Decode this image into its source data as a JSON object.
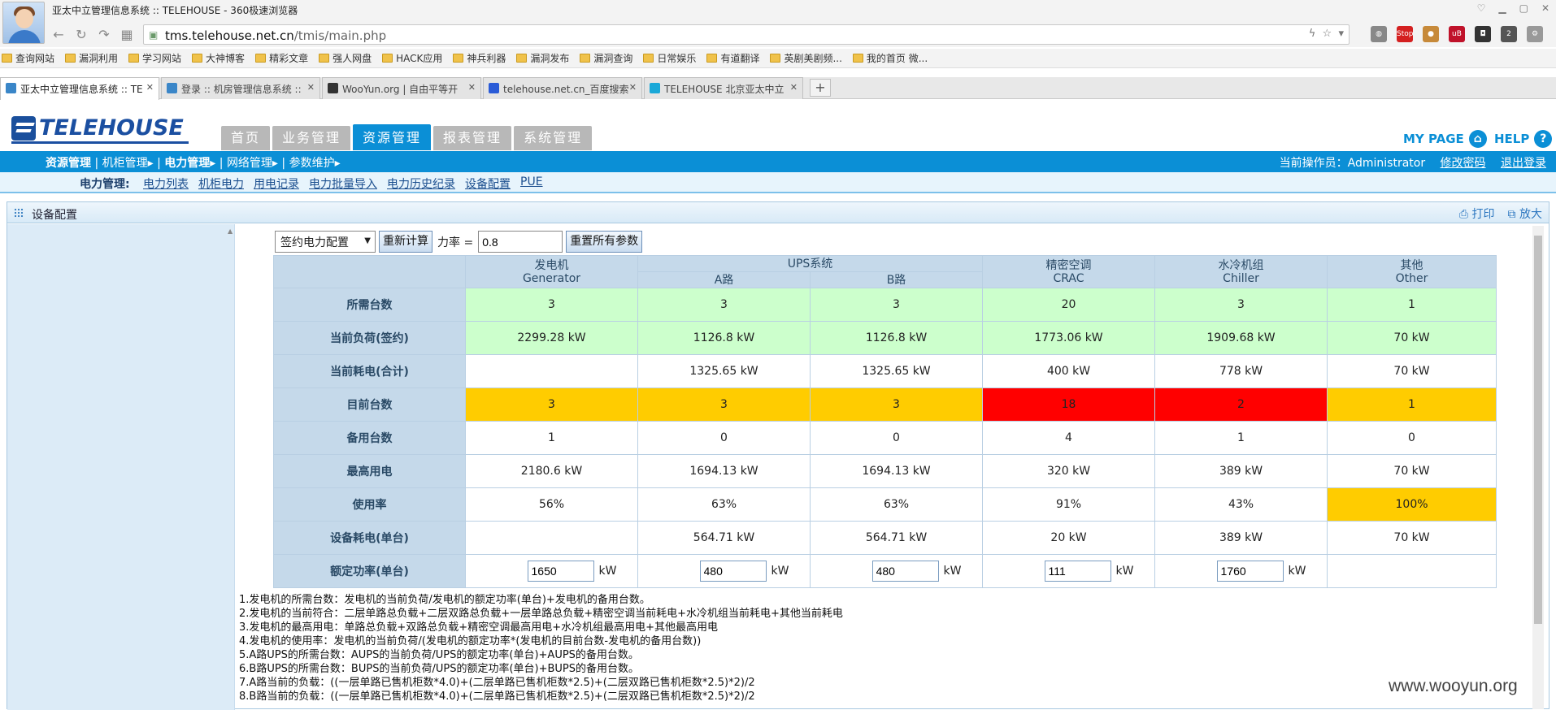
{
  "window": {
    "title": "亚太中立管理信息系统 :: TELEHOUSE - 360极速浏览器"
  },
  "address": {
    "host": "tms.telehouse.net.cn",
    "path": "/tmis/main.php"
  },
  "bookmarks": [
    "查询网站",
    "漏洞利用",
    "学习网站",
    "大神博客",
    "精彩文章",
    "强人网盘",
    "HACK应用",
    "神兵利器",
    "漏洞发布",
    "漏洞查询",
    "日常娱乐",
    "有道翻译",
    "英剧美剧频...",
    "我的首页 微..."
  ],
  "tabs": [
    {
      "label": "亚太中立管理信息系统 :: TE"
    },
    {
      "label": "登录 :: 机房管理信息系统 ::"
    },
    {
      "label": "WooYun.org | 自由平等开"
    },
    {
      "label": "telehouse.net.cn_百度搜索"
    },
    {
      "label": "TELEHOUSE 北京亚太中立"
    }
  ],
  "logo": {
    "text": "TELEHOUSE"
  },
  "main_tabs": [
    "首页",
    "业务管理",
    "资源管理",
    "报表管理",
    "系统管理"
  ],
  "header_links": {
    "mypage": "MY PAGE",
    "help": "HELP"
  },
  "breadcrumb": [
    "资源管理",
    "机柜管理▸",
    "电力管理▸",
    "网络管理▸",
    "参数维护▸"
  ],
  "operator": {
    "label": "当前操作员：Administrator",
    "change_pw": "修改密码",
    "logout": "退出登录"
  },
  "subnav": {
    "label": "电力管理:",
    "links": [
      "电力列表",
      "机柜电力",
      "用电记录",
      "电力批量导入",
      "电力历史纪录",
      "设备配置",
      "PUE"
    ]
  },
  "panel": {
    "title": "设备配置",
    "print": "打印",
    "zoom": "放大"
  },
  "controls": {
    "select_value": "签约电力配置",
    "recalc": "重新计算",
    "pf_label": "力率 =",
    "pf_value": "0.8",
    "reset": "重置所有参数"
  },
  "table": {
    "headers": {
      "gen": [
        "发电机",
        "Generator"
      ],
      "ups": "UPS系统",
      "ups_a": "A路",
      "ups_b": "B路",
      "crac": [
        "精密空调",
        "CRAC"
      ],
      "chiller": [
        "水冷机组",
        "Chiller"
      ],
      "other": [
        "其他",
        "Other"
      ]
    },
    "rows": [
      {
        "label": "所需台数",
        "cells": [
          "3",
          "3",
          "3",
          "20",
          "3",
          "1"
        ]
      },
      {
        "label": "当前负荷(签约)",
        "cells": [
          "2299.28 kW",
          "1126.8 kW",
          "1126.8 kW",
          "1773.06 kW",
          "1909.68 kW",
          "70 kW"
        ]
      },
      {
        "label": "当前耗电(合计)",
        "cells": [
          "",
          "1325.65 kW",
          "1325.65 kW",
          "400 kW",
          "778 kW",
          "70 kW"
        ]
      },
      {
        "label": "目前台数",
        "cells": [
          "3",
          "3",
          "3",
          "18",
          "2",
          "1"
        ]
      },
      {
        "label": "备用台数",
        "cells": [
          "1",
          "0",
          "0",
          "4",
          "1",
          "0"
        ]
      },
      {
        "label": "最高用电",
        "cells": [
          "2180.6 kW",
          "1694.13 kW",
          "1694.13 kW",
          "320 kW",
          "389 kW",
          "70 kW"
        ]
      },
      {
        "label": "使用率",
        "cells": [
          "56%",
          "63%",
          "63%",
          "91%",
          "43%",
          "100%"
        ]
      },
      {
        "label": "设备耗电(单台)",
        "cells": [
          "",
          "564.71 kW",
          "564.71 kW",
          "20 kW",
          "389 kW",
          "70 kW"
        ]
      },
      {
        "label": "额定功率(单台)",
        "inputs": [
          "1650",
          "480",
          "480",
          "111",
          "1760"
        ],
        "unit": "kW"
      }
    ]
  },
  "notes": [
    "1.发电机的所需台数：发电机的当前负荷/发电机的额定功率(单台)+发电机的备用台数。",
    "2.发电机的当前符合：二层单路总负载+二层双路总负载+一层单路总负载+精密空调当前耗电+水冷机组当前耗电+其他当前耗电",
    "3.发电机的最高用电：单路总负载+双路总负载+精密空调最高用电+水冷机组最高用电+其他最高用电",
    "4.发电机的使用率：发电机的当前负荷/(发电机的额定功率*(发电机的目前台数-发电机的备用台数))",
    "5.A路UPS的所需台数：AUPS的当前负荷/UPS的额定功率(单台)+AUPS的备用台数。",
    "6.B路UPS的所需台数：BUPS的当前负荷/UPS的额定功率(单台)+BUPS的备用台数。",
    "7.A路当前的负载：((一层单路已售机柜数*4.0)+(二层单路已售机柜数*2.5)+(二层双路已售机柜数*2.5)*2)/2",
    "8.B路当前的负载：((一层单路已售机柜数*4.0)+(二层单路已售机柜数*2.5)+(二层双路已售机柜数*2.5)*2)/2"
  ],
  "watermark": "www.wooyun.org",
  "colors": {
    "accent": "#0b8fd6",
    "ok": "#ccffcc",
    "warn": "#ffcc00",
    "alert": "#ff0000"
  }
}
